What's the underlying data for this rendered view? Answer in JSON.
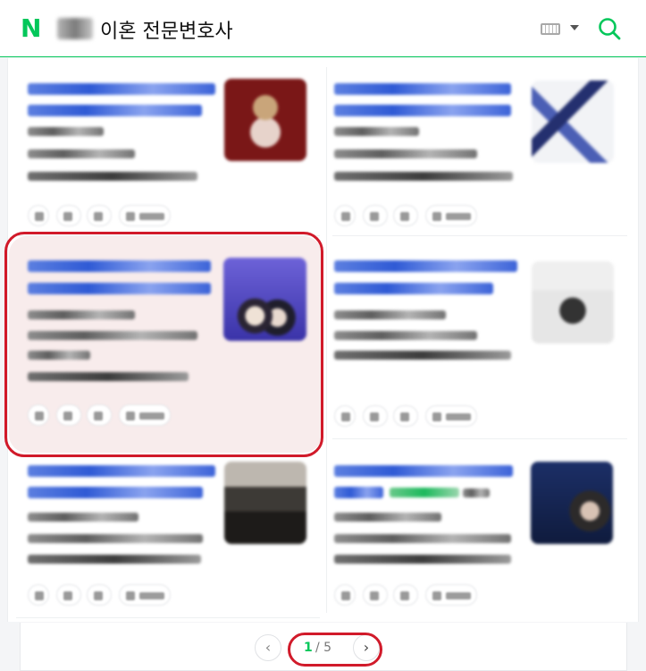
{
  "header": {
    "logo": "N",
    "query": "이혼 전문변호사",
    "keyboard_icon": "keyboard-icon",
    "search_icon": "search-icon"
  },
  "pagination": {
    "prev_icon": "chevron-left-icon",
    "current_page": "1",
    "total_pages": "/ 5",
    "next_icon": "chevron-right-icon"
  },
  "colors": {
    "brand": "#03c75a",
    "annotation": "#d11a2a",
    "link": "#2f5ad5",
    "highlight": "#f8ecec"
  }
}
